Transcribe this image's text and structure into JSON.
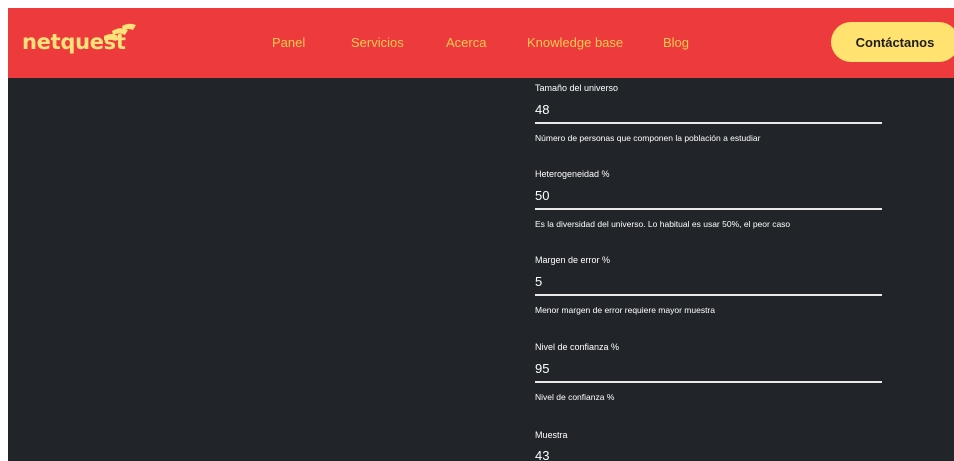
{
  "brand": {
    "name": "netquest",
    "logo_color": "#ffe27a"
  },
  "colors": {
    "nav_background": "#ec3a3d",
    "nav_link": "#f6c94f",
    "page_background": "#212429",
    "cta_background": "#ffe270",
    "text": "#ffffff"
  },
  "nav": {
    "items": [
      {
        "label": "Panel"
      },
      {
        "label": "Servicios"
      },
      {
        "label": "Acerca"
      },
      {
        "label": "Knowledge base"
      },
      {
        "label": "Blog"
      }
    ],
    "cta_label": "Contáctanos"
  },
  "form": {
    "fields": [
      {
        "label": "Tamaño del universo",
        "value": "48",
        "help": "Número de personas que componen la población a estudiar"
      },
      {
        "label": "Heterogeneidad %",
        "value": "50",
        "help": "Es la diversidad del universo. Lo habitual es usar 50%, el peor caso"
      },
      {
        "label": "Margen de error %",
        "value": "5",
        "help": "Menor margen de error requiere mayor muestra"
      },
      {
        "label": "Nivel de confianza %",
        "value": "95",
        "help": "Nivel de confianza %"
      }
    ],
    "result": {
      "label": "Muestra",
      "value": "43"
    }
  }
}
